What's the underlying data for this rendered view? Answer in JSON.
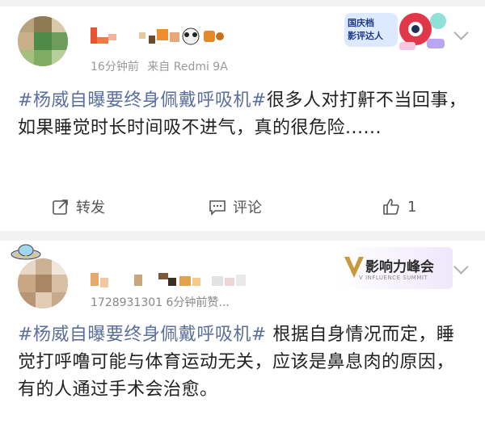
{
  "post1": {
    "meta_time": "16分钟前",
    "meta_source": "来自 Redmi 9A",
    "badge_text_line1": "国庆档",
    "badge_text_line2": "影评达人",
    "hashtag": "#杨威自曝要终身佩戴呼吸机#",
    "text": "很多人对打鼾不当回事，如果睡觉时长时间吸不进气，真的很危险......",
    "actions": {
      "repost": "转发",
      "comment": "评论",
      "like_count": "1"
    }
  },
  "post2": {
    "meta": "1728931301 6分钟前赞...",
    "badge_text": "影响力峰会",
    "badge_sub": "V INFLUENCE SUMMIT",
    "hashtag": "#杨威自曝要终身佩戴呼吸机#",
    "text": " 根据自身情况而定，睡觉打呼噜可能与体育运动无关，应该是鼻息肉的原因，有的人通过手术会治愈。"
  },
  "colors": {
    "hashtag": "#5b6f9f",
    "text": "#222222",
    "meta": "#999999",
    "separator": "#f2f2f2"
  }
}
